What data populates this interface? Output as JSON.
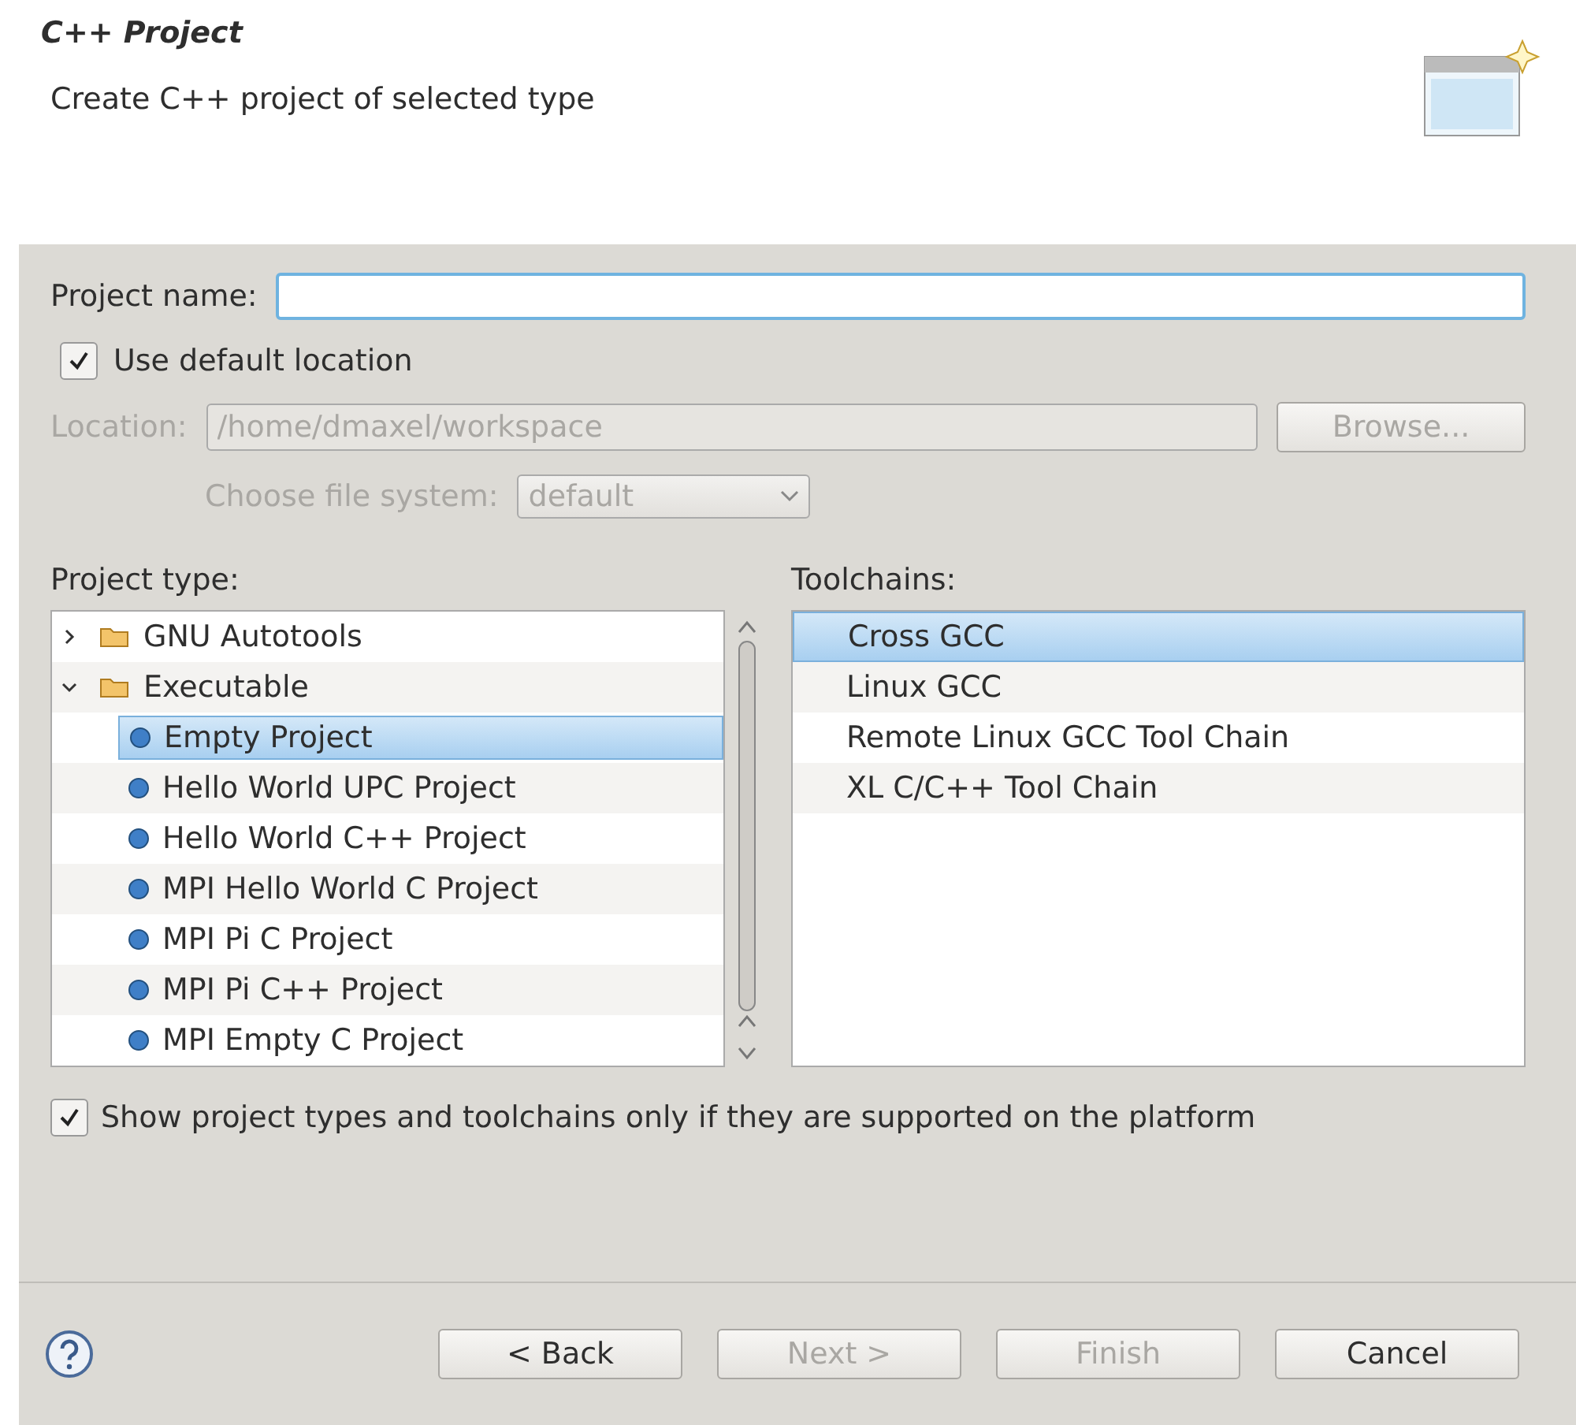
{
  "header": {
    "title": "C++ Project",
    "subtitle": "Create C++ project of selected type"
  },
  "project_name": {
    "label": "Project name:"
  },
  "use_default_location": {
    "label": "Use default location",
    "checked": true
  },
  "location": {
    "label": "Location:",
    "value": "/home/dmaxel/workspace",
    "disabled": true
  },
  "browse_button": {
    "label": "Browse...",
    "disabled": true
  },
  "file_system": {
    "label": "Choose file system:",
    "value": "default",
    "disabled": true
  },
  "project_type": {
    "label": "Project type:",
    "items": [
      {
        "label": "GNU Autotools",
        "kind": "folder",
        "expanded": false,
        "selected": false
      },
      {
        "label": "Executable",
        "kind": "folder",
        "expanded": true,
        "selected": false,
        "children": [
          {
            "label": "Empty Project",
            "kind": "project",
            "selected": true
          },
          {
            "label": "Hello World UPC Project",
            "kind": "project",
            "selected": false
          },
          {
            "label": "Hello World C++ Project",
            "kind": "project",
            "selected": false
          },
          {
            "label": "MPI Hello World C Project",
            "kind": "project",
            "selected": false
          },
          {
            "label": "MPI Pi C Project",
            "kind": "project",
            "selected": false
          },
          {
            "label": "MPI Pi C++ Project",
            "kind": "project",
            "selected": false
          },
          {
            "label": "MPI Empty C Project",
            "kind": "project",
            "selected": false
          }
        ]
      }
    ]
  },
  "toolchains": {
    "label": "Toolchains:",
    "items": [
      {
        "label": "Cross GCC",
        "selected": true
      },
      {
        "label": "Linux GCC",
        "selected": false
      },
      {
        "label": "Remote Linux GCC Tool Chain",
        "selected": false
      },
      {
        "label": "XL C/C++ Tool Chain",
        "selected": false
      }
    ]
  },
  "show_supported": {
    "label": "Show project types and toolchains only if they are supported on the platform",
    "checked": true
  },
  "buttons": [
    {
      "label": "< Back",
      "disabled": false
    },
    {
      "label": "Next >",
      "disabled": true
    },
    {
      "label": "Finish",
      "disabled": true
    },
    {
      "label": "Cancel",
      "disabled": false
    }
  ]
}
